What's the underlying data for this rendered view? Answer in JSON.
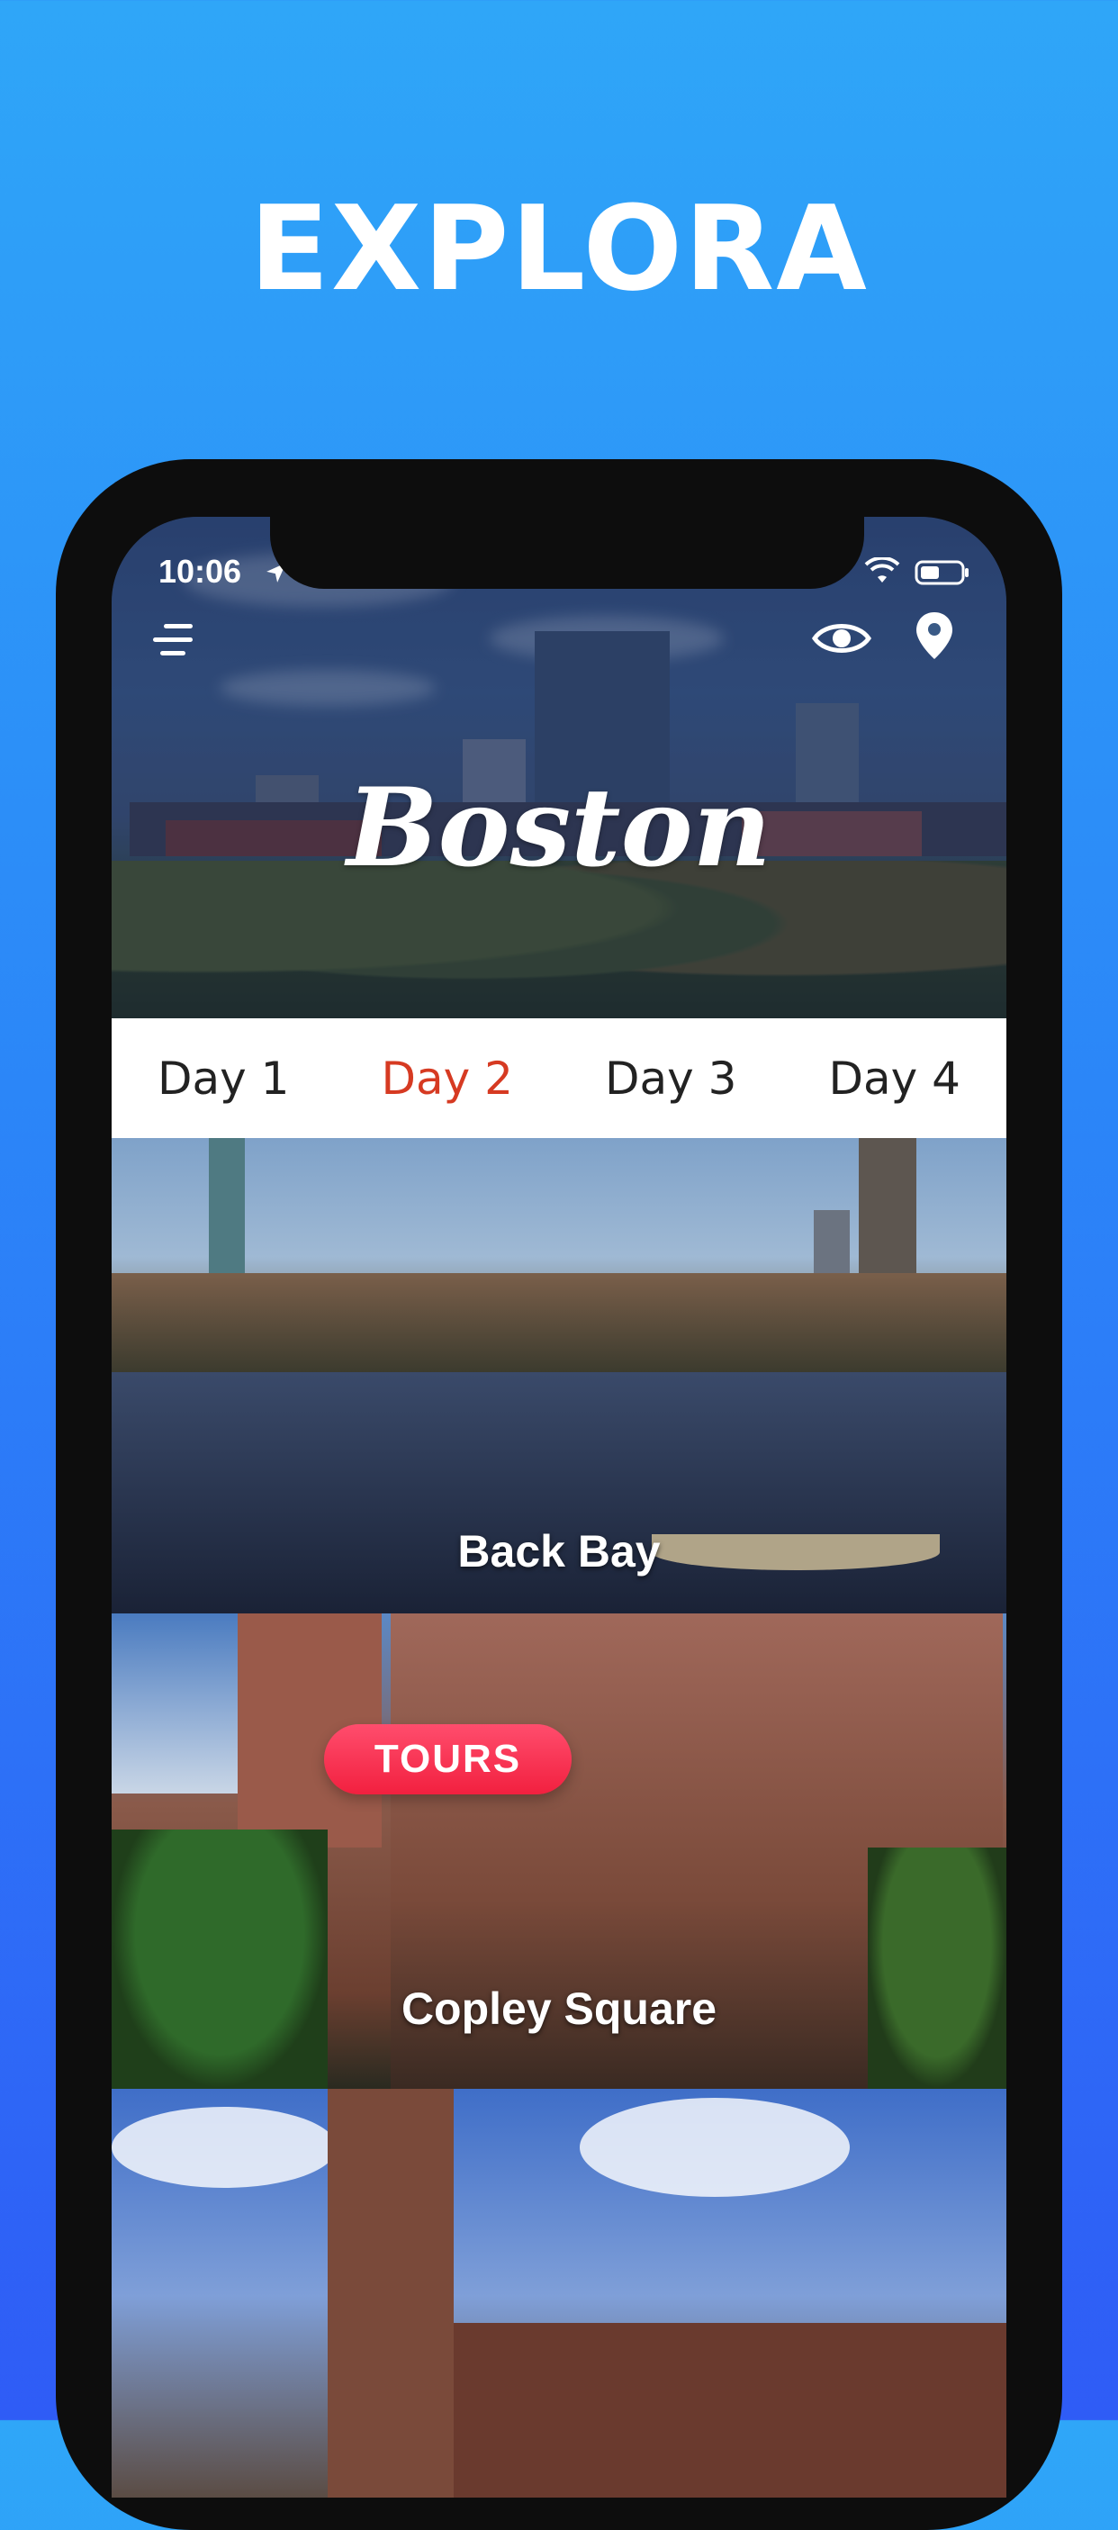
{
  "promo": {
    "title": "EXPLORA"
  },
  "status_bar": {
    "time": "10:06"
  },
  "header": {
    "city": "Boston"
  },
  "tabs": [
    {
      "label": "Day 1",
      "active": false
    },
    {
      "label": "Day 2",
      "active": true
    },
    {
      "label": "Day 3",
      "active": false
    },
    {
      "label": "Day 4",
      "active": false
    }
  ],
  "places": [
    {
      "name": "Back Bay"
    },
    {
      "name": "Copley Square"
    }
  ],
  "tours_button": {
    "label": "TOURS"
  },
  "colors": {
    "active_tab": "#d63a22",
    "tours_pill": "#f2203f",
    "background_top": "#2fa6f8",
    "background_bottom": "#2f5cf6"
  },
  "icons": [
    "menu-icon",
    "eye-icon",
    "location-pin-icon",
    "wifi-icon",
    "battery-icon",
    "location-arrow-icon"
  ]
}
